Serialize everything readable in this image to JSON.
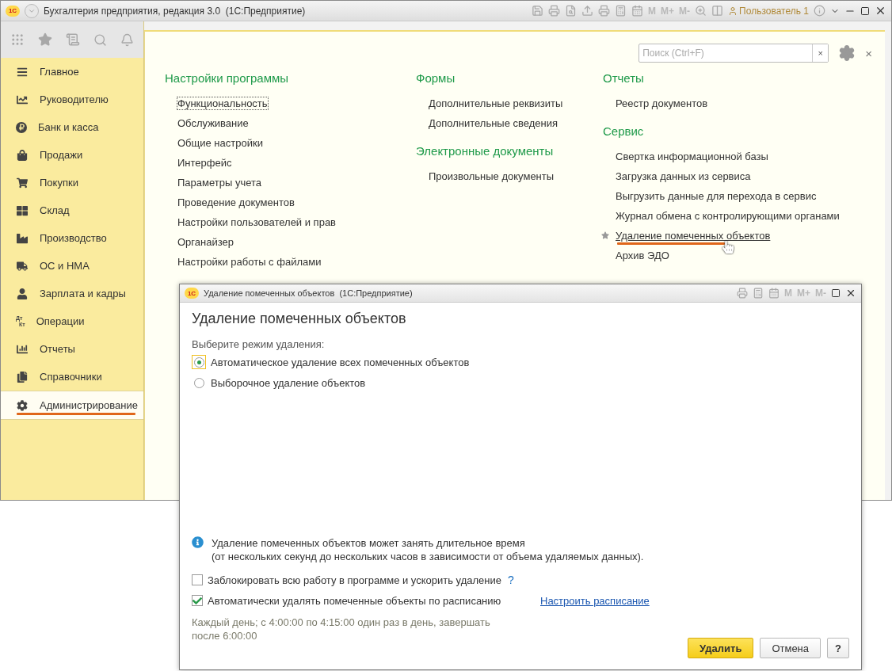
{
  "window": {
    "logo": "1С",
    "title": "Бухгалтерия предприятия, редакция 3.0  (1С:Предприятие)",
    "memory_buttons": [
      "M",
      "M+",
      "M-"
    ],
    "user": "Пользователь 1"
  },
  "sidebar": {
    "items": [
      {
        "label": "Главное",
        "selected": false
      },
      {
        "label": "Руководителю",
        "selected": false
      },
      {
        "label": "Банк и касса",
        "selected": false
      },
      {
        "label": "Продажи",
        "selected": false
      },
      {
        "label": "Покупки",
        "selected": false
      },
      {
        "label": "Склад",
        "selected": false
      },
      {
        "label": "Производство",
        "selected": false
      },
      {
        "label": "ОС и НМА",
        "selected": false
      },
      {
        "label": "Зарплата и кадры",
        "selected": false
      },
      {
        "label": "Операции",
        "selected": false,
        "icon_text": [
          "Дт",
          "Кт"
        ]
      },
      {
        "label": "Отчеты",
        "selected": false
      },
      {
        "label": "Справочники",
        "selected": false
      },
      {
        "label": "Администрирование",
        "selected": true
      }
    ]
  },
  "panel": {
    "search": {
      "placeholder": "Поиск (Ctrl+F)",
      "clear": "×"
    },
    "close": "×",
    "columns": [
      [
        {
          "title": "Настройки программы",
          "links": [
            {
              "label": "Функциональность",
              "favorite": false,
              "hovered": false,
              "focused": true
            },
            {
              "label": "Обслуживание",
              "favorite": false,
              "hovered": false,
              "focused": false
            },
            {
              "label": "Общие настройки",
              "favorite": false,
              "hovered": false,
              "focused": false
            },
            {
              "label": "Интерфейс",
              "favorite": false,
              "hovered": false,
              "focused": false
            },
            {
              "label": "Параметры учета",
              "favorite": false,
              "hovered": false,
              "focused": false
            },
            {
              "label": "Проведение документов",
              "favorite": false,
              "hovered": false,
              "focused": false
            },
            {
              "label": "Настройки пользователей и прав",
              "favorite": false,
              "hovered": false,
              "focused": false
            },
            {
              "label": "Органайзер",
              "favorite": false,
              "hovered": false,
              "focused": false
            },
            {
              "label": "Настройки работы с файлами",
              "favorite": false,
              "hovered": false,
              "focused": false
            }
          ]
        }
      ],
      [
        {
          "title": "Формы",
          "links": [
            {
              "label": "Дополнительные реквизиты",
              "favorite": false,
              "hovered": false,
              "focused": false
            },
            {
              "label": "Дополнительные сведения",
              "favorite": false,
              "hovered": false,
              "focused": false
            }
          ]
        },
        {
          "title": "Электронные документы",
          "links": [
            {
              "label": "Произвольные документы",
              "favorite": false,
              "hovered": false,
              "focused": false
            }
          ]
        }
      ],
      [
        {
          "title": "Отчеты",
          "links": [
            {
              "label": "Реестр документов",
              "favorite": false,
              "hovered": false,
              "focused": false
            }
          ]
        },
        {
          "title": "Сервис",
          "links": [
            {
              "label": "Свертка информационной базы",
              "favorite": false,
              "hovered": false,
              "focused": false
            },
            {
              "label": "Загрузка данных из сервиса",
              "favorite": false,
              "hovered": false,
              "focused": false
            },
            {
              "label": "Выгрузить данные для перехода в сервис",
              "favorite": false,
              "hovered": false,
              "focused": false
            },
            {
              "label": "Журнал обмена с контролирующими органами",
              "favorite": false,
              "hovered": false,
              "focused": false
            },
            {
              "label": "Удаление помеченных объектов",
              "favorite": true,
              "hovered": true,
              "focused": false
            },
            {
              "label": "Архив ЭДО",
              "favorite": false,
              "hovered": false,
              "focused": false
            }
          ]
        }
      ]
    ]
  },
  "dialog": {
    "logo": "1С",
    "title": "Удаление помеченных объектов  (1С:Предприятие)",
    "memory_buttons": [
      "M",
      "M+",
      "M-"
    ],
    "heading": "Удаление помеченных объектов",
    "mode_label": "Выберите режим удаления:",
    "modes": [
      {
        "label": "Автоматическое удаление всех помеченных объектов",
        "selected": true
      },
      {
        "label": "Выборочное удаление объектов",
        "selected": false
      }
    ],
    "info": [
      "Удаление помеченных объектов может занять длительное время",
      "(от нескольких секунд до нескольких часов в зависимости от объема удаляемых данных)."
    ],
    "options": [
      {
        "label": "Заблокировать всю работу в программе и ускорить удаление",
        "checked": false,
        "help": "?"
      },
      {
        "label": "Автоматически удалять помеченные объекты по расписанию",
        "checked": true,
        "link": "Настроить расписание"
      }
    ],
    "schedule": "Каждый день; с 4:00:00 по 4:15:00 один раз в день, завершать после 6:00:00",
    "buttons": [
      {
        "label": "Удалить",
        "kind": "primary"
      },
      {
        "label": "Отмена",
        "kind": "default"
      },
      {
        "label": "?",
        "kind": "help"
      }
    ]
  }
}
